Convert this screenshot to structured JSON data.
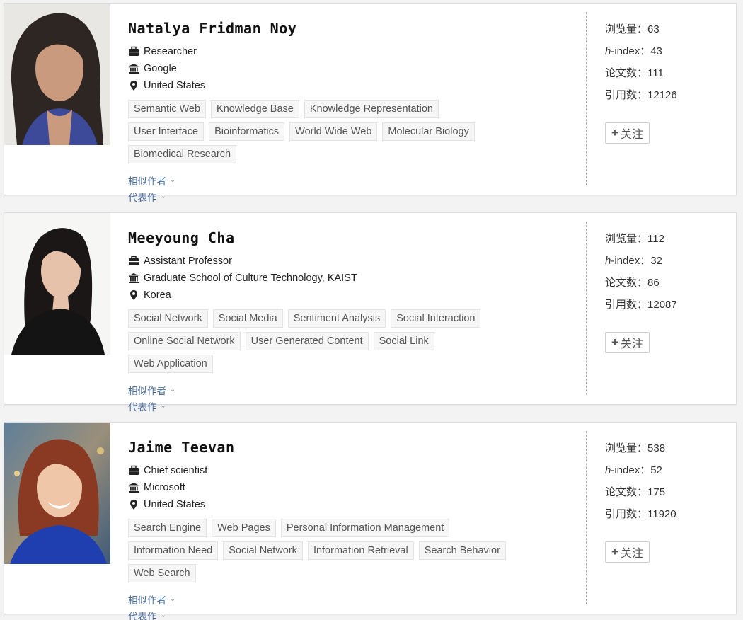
{
  "stat_labels": {
    "views": "浏览量：",
    "h_prefix": "h",
    "h_suffix": "-index：",
    "papers": "论文数：",
    "citations": "引用数："
  },
  "labels": {
    "similar_authors": "相似作者",
    "representative_works": "代表作",
    "follow": "关注",
    "chevron": "⌄"
  },
  "icons": {
    "position": "briefcase-icon",
    "affiliation": "institution-icon",
    "location": "map-pin-icon"
  },
  "authors": [
    {
      "name": "Natalya Fridman Noy",
      "position": "Researcher",
      "affiliation": "Google",
      "location": "United States",
      "tags": [
        "Semantic Web",
        "Knowledge Base",
        "Knowledge Representation",
        "User Interface",
        "Bioinformatics",
        "World Wide Web",
        "Molecular Biology",
        "Biomedical Research"
      ],
      "views": "63",
      "h_index": "43",
      "papers": "111",
      "citations": "12126"
    },
    {
      "name": "Meeyoung Cha",
      "position": "Assistant Professor",
      "affiliation": "Graduate School of Culture Technology, KAIST",
      "location": "Korea",
      "tags": [
        "Social Network",
        "Social Media",
        "Sentiment Analysis",
        "Social Interaction",
        "Online Social Network",
        "User Generated Content",
        "Social Link",
        "Web Application"
      ],
      "views": "112",
      "h_index": "32",
      "papers": "86",
      "citations": "12087"
    },
    {
      "name": "Jaime Teevan",
      "position": "Chief scientist",
      "affiliation": "Microsoft",
      "location": "United States",
      "tags": [
        "Search Engine",
        "Web Pages",
        "Personal Information Management",
        "Information Need",
        "Social Network",
        "Information Retrieval",
        "Search Behavior",
        "Web Search"
      ],
      "views": "538",
      "h_index": "52",
      "papers": "175",
      "citations": "11920"
    }
  ]
}
